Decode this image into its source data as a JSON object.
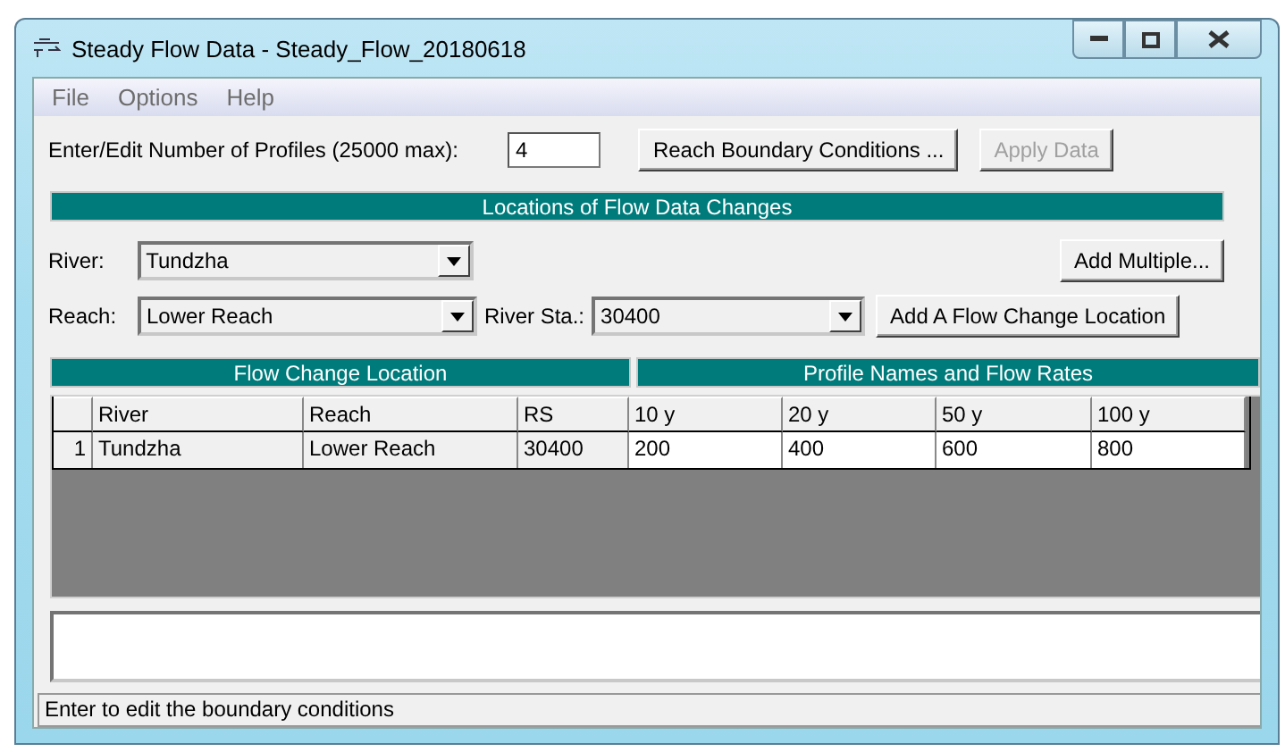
{
  "window": {
    "title": "Steady Flow Data - Steady_Flow_20180618"
  },
  "menu": [
    "File",
    "Options",
    "Help"
  ],
  "profiles": {
    "label": "Enter/Edit Number of Profiles (25000 max):",
    "value": "4"
  },
  "buttons": [
    {
      "label": "Reach Boundary Conditions ...",
      "disabled": false
    },
    {
      "label": "Apply Data",
      "disabled": true
    }
  ],
  "locations": {
    "title": "Locations of Flow Data Changes",
    "river": {
      "label": "River:",
      "value": "Tundzha"
    },
    "reach": {
      "label": "Reach:",
      "value": "Lower Reach"
    },
    "river_sta": {
      "label": "River Sta.:",
      "value": "30400"
    },
    "add_multiple": "Add Multiple...",
    "add_location": "Add A Flow Change Location"
  },
  "table": {
    "group_headers": [
      "Flow Change Location",
      "Profile Names and Flow Rates"
    ],
    "columns": [
      "River",
      "Reach",
      "RS",
      "10 y",
      "20 y",
      "50 y",
      "100 y"
    ],
    "rows": [
      {
        "number": "1",
        "cells": [
          "Tundzha",
          "Lower Reach",
          "30400",
          "200",
          "400",
          "600",
          "800"
        ]
      }
    ]
  },
  "status_bar": "Enter to edit the boundary conditions"
}
